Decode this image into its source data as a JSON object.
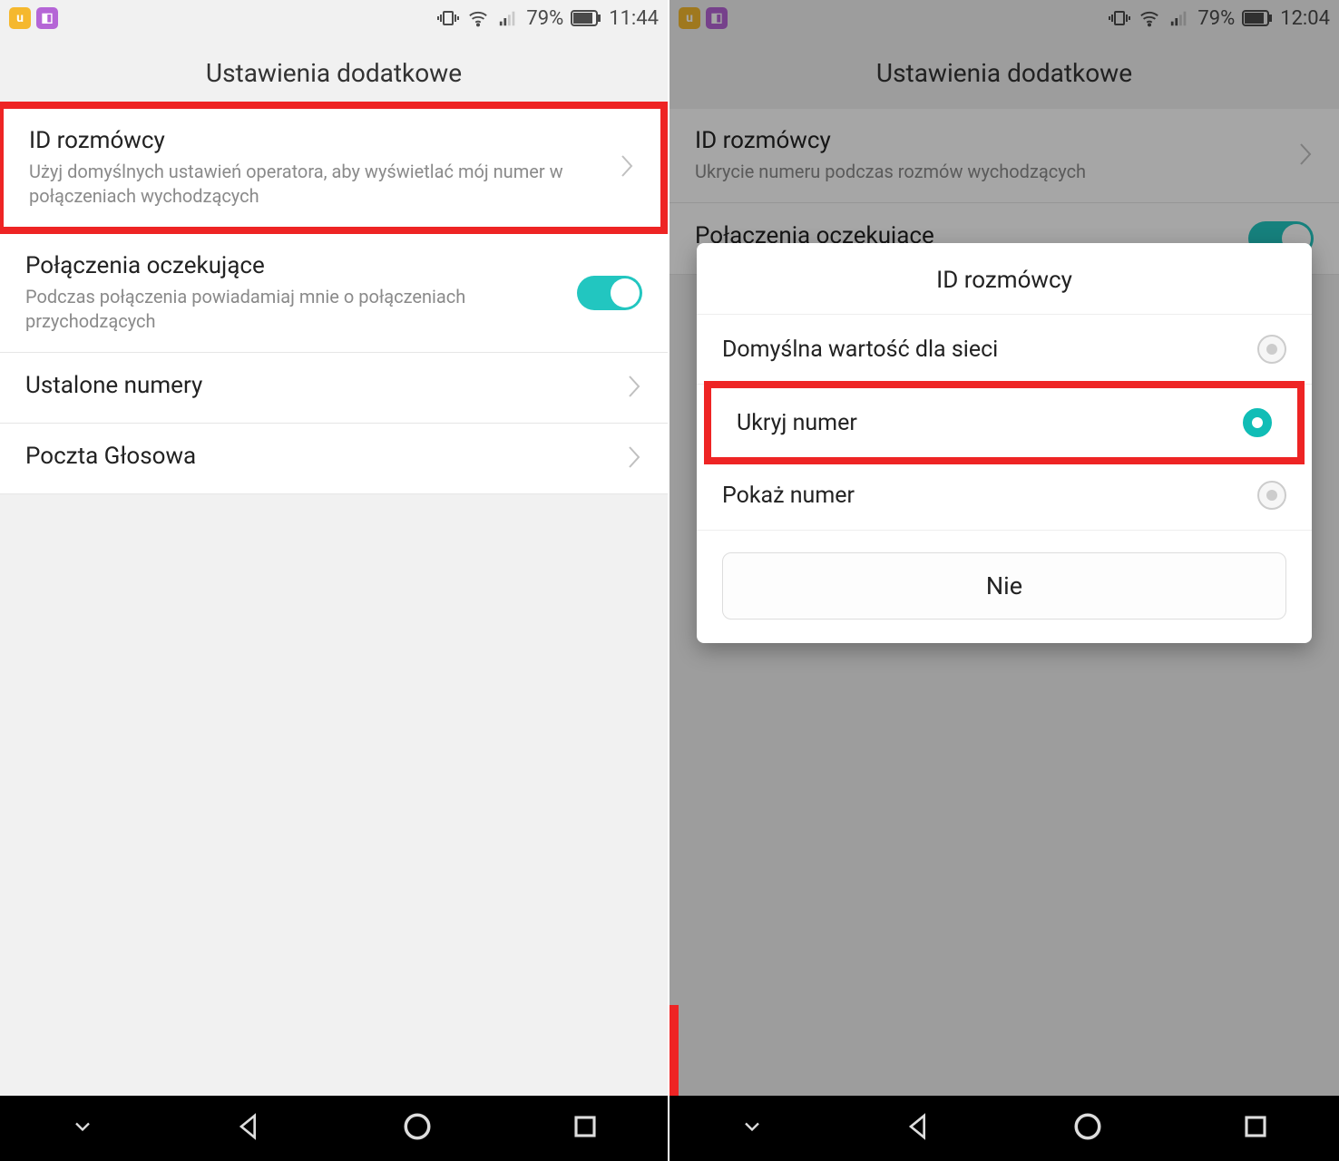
{
  "status": {
    "battery": "79%",
    "left_time": "11:44",
    "right_time": "12:04"
  },
  "header": "Ustawienia dodatkowe",
  "left": {
    "caller_id": {
      "title": "ID rozmówcy",
      "sub": "Użyj domyślnych ustawień operatora, aby wyświetlać mój numer w połączeniach wychodzących"
    },
    "call_waiting": {
      "title": "Połączenia oczekujące",
      "sub": "Podczas połączenia powiadamiaj mnie o połączeniach przychodzących"
    },
    "fixed_numbers": "Ustalone numery",
    "voicemail": "Poczta Głosowa"
  },
  "right": {
    "caller_id": {
      "title": "ID rozmówcy",
      "sub": "Ukrycie numeru podczas rozmów wychodzących"
    },
    "call_waiting": {
      "title": "Połączenia oczekujące"
    }
  },
  "dialog": {
    "title": "ID rozmówcy",
    "options": {
      "default_net": "Domyślna wartość dla sieci",
      "hide_number": "Ukryj numer",
      "show_number": "Pokaż numer"
    },
    "cancel": "Nie"
  }
}
